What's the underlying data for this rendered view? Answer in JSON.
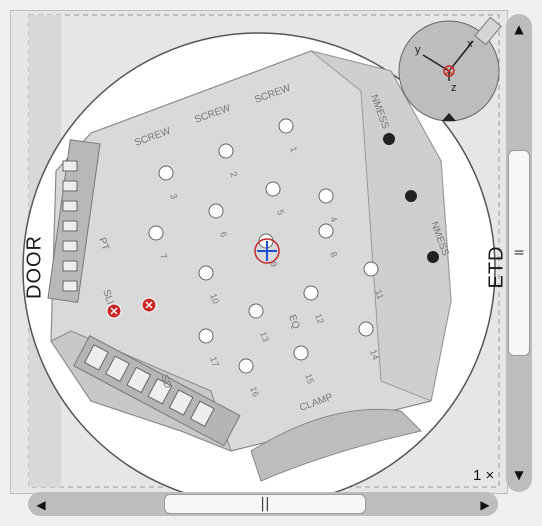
{
  "view": {
    "door_label": "DOOR",
    "etd_label": "ETD",
    "zoom_label": "1 ×",
    "plate_labels": {
      "screw_1": "SCREW",
      "screw_2": "SCREW",
      "screw_3": "SCREW",
      "nmess_1": "NMESS",
      "nmess_2": "NMESS",
      "clamp": "CLAMP",
      "slide": "SLIDE",
      "eq": "EQ",
      "pt": "PT",
      "sd": "SD"
    },
    "hole_numbers": [
      "1",
      "2",
      "3",
      "4",
      "5",
      "6",
      "7",
      "8",
      "9",
      "10",
      "11",
      "12",
      "13",
      "14",
      "15",
      "16",
      "17",
      "18",
      "19",
      "20"
    ],
    "colors": {
      "plate": "#d9d9d9",
      "plate_edge": "#909090",
      "background": "#e6e6e6",
      "marker_red": "#c62828",
      "crosshair_blue": "#1a4fd6",
      "compass_bg": "#bdbdbd"
    },
    "compass": {
      "axis_x": "x",
      "axis_y": "y",
      "axis_z": "z",
      "icon": "orientation-compass-icon"
    },
    "markers": [
      "red-marker-icon",
      "red-marker-icon"
    ],
    "crosshair": "crosshair-icon"
  },
  "scrollbars": {
    "up_arrow": "▲",
    "down_arrow": "▼",
    "left_arrow": "◀",
    "right_arrow": "▶",
    "v_grip": "=",
    "h_grip": "||"
  }
}
